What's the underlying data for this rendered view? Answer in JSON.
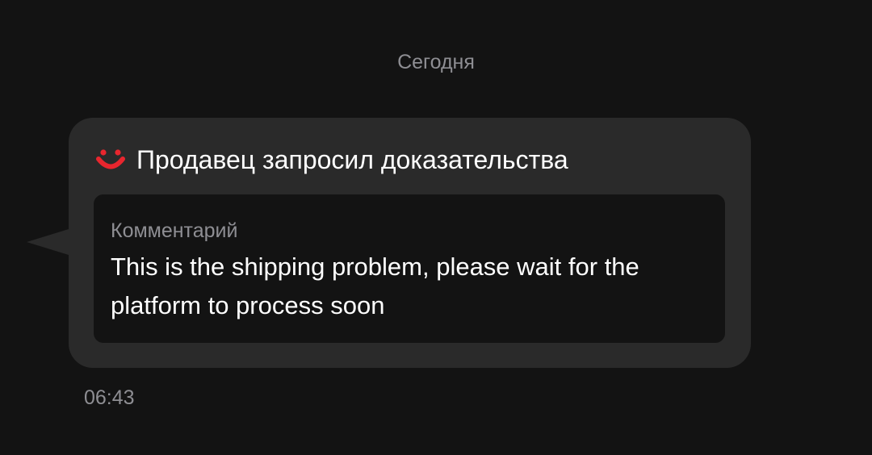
{
  "date_divider": "Сегодня",
  "message": {
    "icon": "smile-icon",
    "icon_color": "#e8262e",
    "title": "Продавец запросил доказательства",
    "comment": {
      "label": "Комментарий",
      "text": "This is the shipping problem, please wait for the platform to process soon"
    },
    "time": "06:43"
  },
  "colors": {
    "background": "#131313",
    "bubble": "#2a2a2a",
    "comment_box": "#131313",
    "muted_text": "#8e8e93",
    "primary_text": "#ffffff"
  }
}
